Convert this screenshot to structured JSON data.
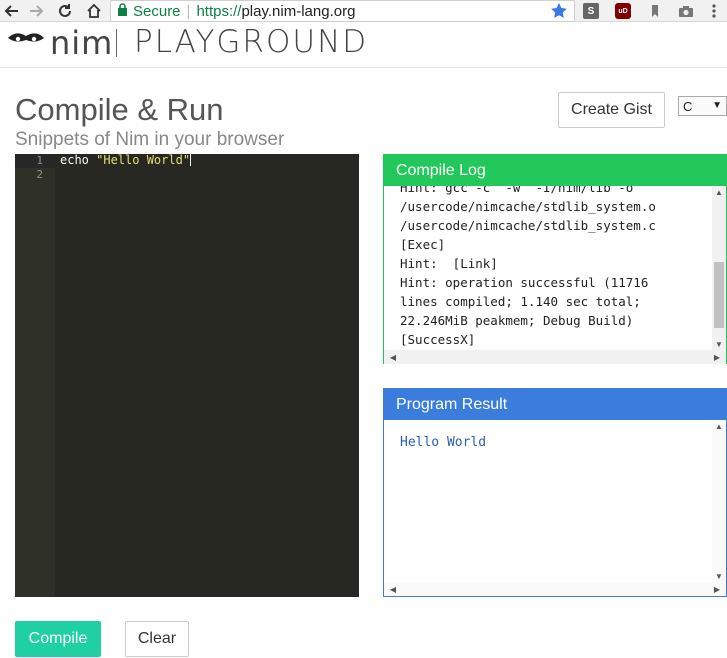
{
  "browser": {
    "secure_label": "Secure",
    "url_scheme": "https://",
    "url_host": "play.nim-lang.org",
    "icons": [
      "back-icon",
      "forward-icon",
      "reload-icon",
      "home-icon",
      "lock-icon",
      "bookmark-star-icon",
      "s-extension-icon",
      "ublock-icon",
      "bookmark-extension-icon",
      "camera-icon",
      "menu-icon"
    ],
    "s_ext_label": "S",
    "ublock_label": "uD"
  },
  "header": {
    "logo_text": "nim",
    "title": "PLAYGROUND"
  },
  "page": {
    "title": "Compile & Run",
    "subtitle": "Snippets of Nim in your browser"
  },
  "toolbar": {
    "gist_label": "Create Gist",
    "language_value": "C"
  },
  "editor": {
    "lines": [
      {
        "no": "1",
        "keyword": "echo ",
        "string": "\"Hello World\""
      },
      {
        "no": "2",
        "keyword": "",
        "string": ""
      }
    ]
  },
  "compile_log": {
    "title": "Compile Log",
    "lines": [
      "Hint: gcc -c  -w  -I/nim/lib -o",
      "/usercode/nimcache/stdlib_system.o",
      "/usercode/nimcache/stdlib_system.c",
      "[Exec]",
      "Hint:  [Link]",
      "Hint: operation successful (11716",
      "lines compiled; 1.140 sec total;",
      "22.246MiB peakmem; Debug Build)",
      "[SuccessX]"
    ]
  },
  "program_result": {
    "title": "Program Result",
    "output": "Hello World"
  },
  "actions": {
    "compile_label": "Compile",
    "clear_label": "Clear"
  },
  "colors": {
    "compile_log_header": "#22c85a",
    "program_result_header": "#3b7ddd",
    "compile_button": "#1fd0a2",
    "editor_bg": "#272822",
    "secure_green": "#0b8043"
  }
}
